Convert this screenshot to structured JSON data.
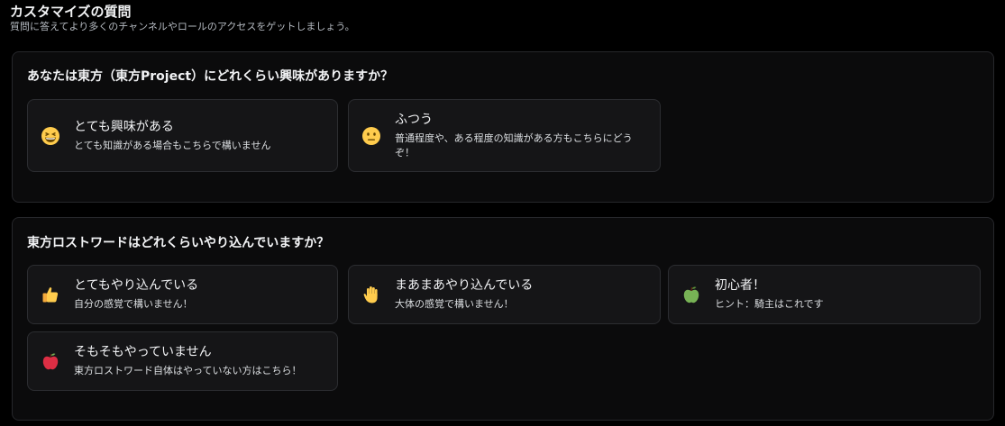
{
  "header": {
    "title": "カスタマイズの質問",
    "subtitle": "質問に答えてより多くのチャンネルやロールのアクセスをゲットしましょう。"
  },
  "questions": [
    {
      "title": "あなたは東方（東方Project）にどれくらい興味がありますか？",
      "options": [
        {
          "icon": "grinning-squinting-face-icon",
          "label": "とても興味がある",
          "desc": "とても知識がある場合もこちらで構いません"
        },
        {
          "icon": "neutral-face-icon",
          "label": "ふつう",
          "desc": "普通程度や、ある程度の知識がある方もこちらにどうぞ！"
        }
      ]
    },
    {
      "title": "東方ロストワードはどれくらいやり込んでいますか？",
      "options": [
        {
          "icon": "thumbs-up-icon",
          "label": "とてもやり込んでいる",
          "desc": "自分の感覚で構いません！"
        },
        {
          "icon": "raised-hand-icon",
          "label": "まあまあやり込んでいる",
          "desc": "大体の感覚で構いません！"
        },
        {
          "icon": "green-apple-icon",
          "label": "初心者！",
          "desc": "ヒント：騎主はこれです"
        },
        {
          "icon": "red-apple-icon",
          "label": "そもそもやっていません",
          "desc": "東方ロストワード自体はやっていない方はこちら！"
        }
      ]
    }
  ]
}
